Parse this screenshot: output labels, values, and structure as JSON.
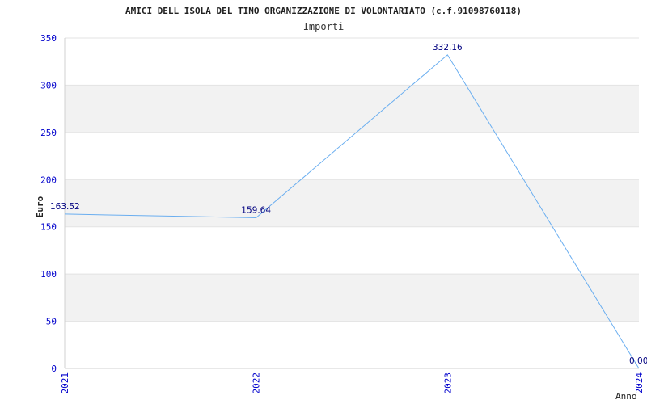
{
  "chart_data": {
    "type": "line",
    "title": "AMICI DELL ISOLA DEL TINO ORGANIZZAZIONE DI VOLONTARIATO (c.f.91098760118)",
    "subtitle": "Importi",
    "xlabel": "Anno",
    "ylabel": "Euro",
    "categories": [
      "2021",
      "2022",
      "2023",
      "2024"
    ],
    "series": [
      {
        "values": [
          163.52,
          159.64,
          332.16,
          0.0
        ]
      }
    ],
    "data_labels": [
      "163.52",
      "159.64",
      "332.16",
      "0.00"
    ],
    "y_ticks": [
      "0",
      "50",
      "100",
      "150",
      "200",
      "250",
      "300",
      "350"
    ],
    "ylim": [
      0,
      350
    ],
    "grid": true,
    "legend": "none",
    "colors": {
      "line": "#6aaef0",
      "band": "#f2f2f2",
      "tick_text": "#0000cc",
      "label_text": "#000080",
      "title_text": "#222222"
    }
  }
}
